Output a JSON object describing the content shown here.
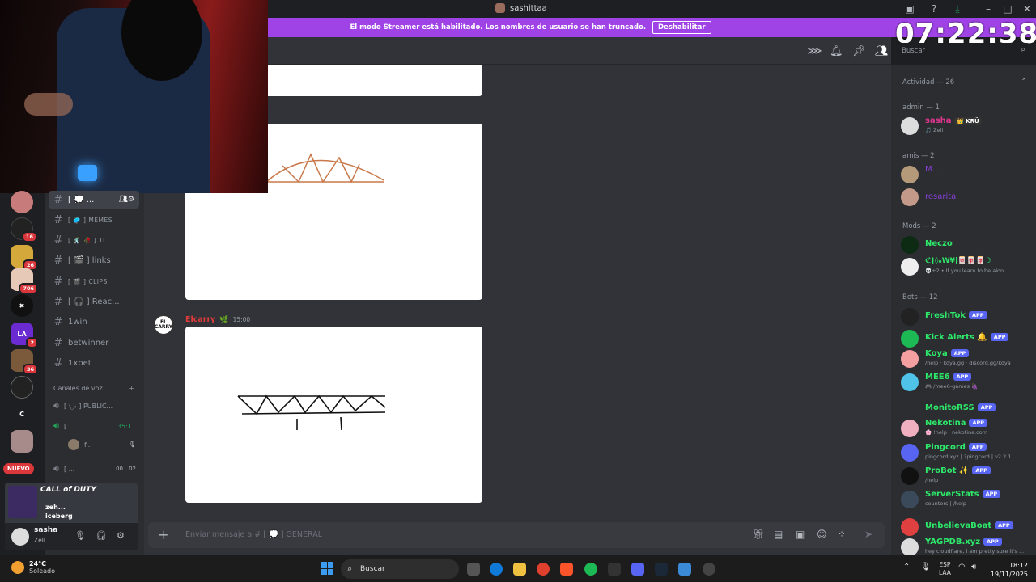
{
  "window": {
    "title": "sashittaa"
  },
  "streamer_banner": {
    "message": "El modo Streamer está habilitado. Los nombres de usuario se han truncado.",
    "button": "Deshabilitar"
  },
  "overlay_clock": "07:22:38",
  "servers": [
    {
      "badge": ""
    },
    {
      "badge": "16"
    },
    {
      "badge": "26"
    },
    {
      "badge": "706"
    },
    {
      "badge": ""
    },
    {
      "label": "LA",
      "badge": "2"
    },
    {
      "badge": "36"
    },
    {
      "badge": ""
    },
    {
      "label": "C",
      "badge": ""
    },
    {
      "badge": ""
    }
  ],
  "nuevo": "NUEVO",
  "channels": [
    {
      "label": "[ 💭 ...",
      "active": true
    },
    {
      "label": "[ 🥏 ] MEMES"
    },
    {
      "label": "[ 🕺 🥀 ] TI..."
    },
    {
      "label": "[ 🎬 ] links"
    },
    {
      "label": "[ 🎬 ] CLIPS"
    },
    {
      "label": "[ 🎧 ] Reac..."
    },
    {
      "label": "1win"
    },
    {
      "label": "betwinner"
    },
    {
      "label": "1xbet"
    }
  ],
  "voice": {
    "header": "Canales de voz",
    "channels": [
      {
        "label": "[ 🗣 ] PUBLIC..."
      },
      {
        "label": "[ ...",
        "time": "35:11"
      },
      {
        "label": "f..."
      },
      {
        "label": "[ ...",
        "count_a": "00",
        "count_b": "02"
      }
    ]
  },
  "game_activity": {
    "game": "CALL of DUTY",
    "line1": "zeh...",
    "line2": "iceberg"
  },
  "user": {
    "name": "sasha",
    "status": "Zell"
  },
  "message": {
    "author": "Elcarry",
    "time": "15:00",
    "avatar_text": "EL CARRY"
  },
  "composer": {
    "placeholder": "Enviar mensaje a # [ 💭 ] GENERAL"
  },
  "search": {
    "placeholder": "Buscar"
  },
  "members": {
    "header": "Actividad — 26",
    "sections": [
      {
        "title": "admin — 1",
        "items": [
          {
            "name": "sasha",
            "tag": "👑 KRÜ",
            "sub": "🎵 Zell",
            "color": "#e0368f"
          }
        ]
      },
      {
        "title": "amis — 2",
        "items": [
          {
            "name": "M...",
            "color": "#8a3fdb"
          },
          {
            "name": "rosarita",
            "color": "#8a3fdb"
          }
        ]
      },
      {
        "title": "Mods — 2",
        "items": [
          {
            "name": "Neczo",
            "color": "#2ee86a"
          },
          {
            "name": "ℭ†◊ₒW¥|🀄🀄🀄☽",
            "sub": "💀+2 • If you learn to be alon...",
            "color": "#2ee86a"
          }
        ]
      },
      {
        "title": "Bots — 12",
        "items": [
          {
            "name": "FreshTok",
            "app": "APP",
            "color": "#2ee86a"
          },
          {
            "name": "Kick Alerts 🔔",
            "app": "APP",
            "color": "#2ee86a"
          },
          {
            "name": "Koya",
            "app": "APP",
            "sub": "/help · koya.gg · discord.gg/koya",
            "color": "#2ee86a"
          },
          {
            "name": "MEE6",
            "app": "APP",
            "sub": "🎮 /mee6-games 🍇",
            "color": "#2ee86a"
          },
          {
            "name": "MonitoRSS",
            "app": "APP",
            "color": "#2ee86a"
          },
          {
            "name": "Nekotina",
            "app": "APP",
            "sub": "🌸 !help · nekotina.com",
            "color": "#2ee86a"
          },
          {
            "name": "Pingcord",
            "app": "APP",
            "sub": "pingcord.xyz | ?pingcord | v2.2.1",
            "color": "#2ee86a"
          },
          {
            "name": "ProBot ✨",
            "app": "APP",
            "sub": "/help",
            "color": "#2ee86a"
          },
          {
            "name": "ServerStats",
            "app": "APP",
            "sub": "counters | /help",
            "color": "#2ee86a"
          },
          {
            "name": "UnbelievaBoat",
            "app": "APP",
            "color": "#2ee86a"
          },
          {
            "name": "YAGPDB.xyz",
            "app": "APP",
            "sub": "hey cloudflare, i am pretty sure it's ...",
            "color": "#2ee86a"
          }
        ]
      }
    ]
  },
  "taskbar": {
    "weather_temp": "24°C",
    "weather_desc": "Soleado",
    "search": "Buscar",
    "lang1": "ESP",
    "lang2": "LAA",
    "time": "18:12",
    "date": "19/11/2025"
  }
}
